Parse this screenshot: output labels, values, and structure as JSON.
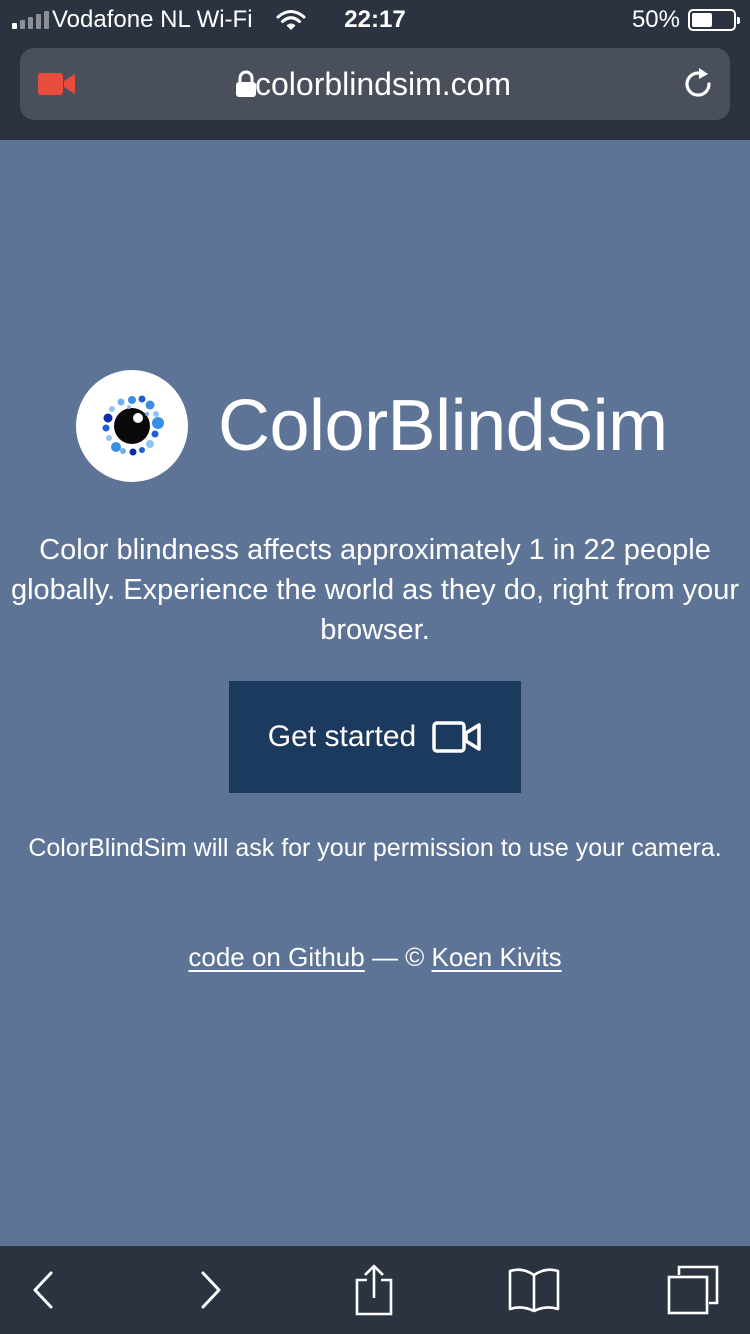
{
  "status_bar": {
    "carrier": "Vodafone NL Wi-Fi",
    "time": "22:17",
    "battery_percent": "50%",
    "battery_level": 0.5
  },
  "address_bar": {
    "url": "colorblindsim.com",
    "recording_indicator_color": "#e74c3c"
  },
  "page": {
    "brand": "ColorBlindSim",
    "tagline": "Color blindness affects approximately 1 in 22 people globally. Experience the world as they do, right from your browser.",
    "cta_label": "Get started",
    "permission_note": "ColorBlindSim will ask for your permission to use your camera.",
    "github_link": "code on Github",
    "separator": " — © ",
    "author_link": "Koen Kivits"
  },
  "toolbar": {
    "icons": [
      "back-icon",
      "forward-icon",
      "share-icon",
      "bookmarks-icon",
      "tabs-icon"
    ]
  },
  "colors": {
    "background": "#5e7496",
    "chrome": "#2b3240",
    "button": "#1c3a5e"
  }
}
